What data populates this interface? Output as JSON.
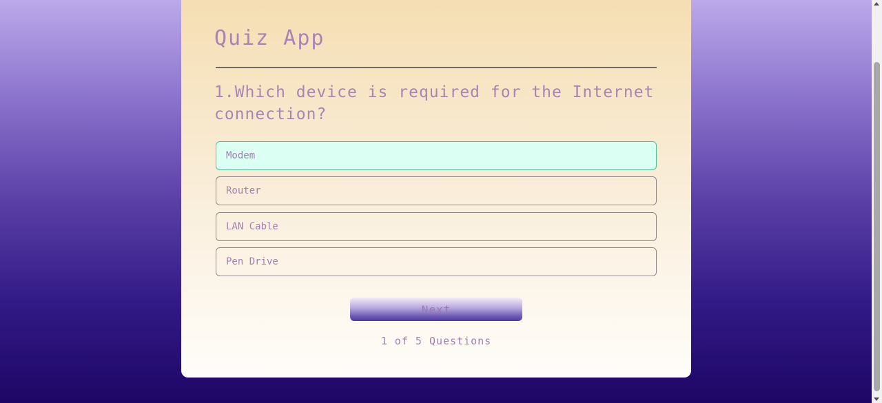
{
  "app": {
    "title": "Quiz App"
  },
  "quiz": {
    "question": "1.Which device is required for the Internet connection?",
    "options": [
      {
        "label": "Modem",
        "selected": true
      },
      {
        "label": "Router",
        "selected": false
      },
      {
        "label": "LAN Cable",
        "selected": false
      },
      {
        "label": "Pen Drive",
        "selected": false
      }
    ],
    "next_label": "Next",
    "progress_text": "1 of 5 Questions"
  },
  "colors": {
    "text_accent": "#a884b6",
    "selected_bg": "#dcfff3",
    "selected_border": "#49c59c",
    "page_bg_top": "#bba9ea",
    "page_bg_bottom": "#1d0665"
  }
}
